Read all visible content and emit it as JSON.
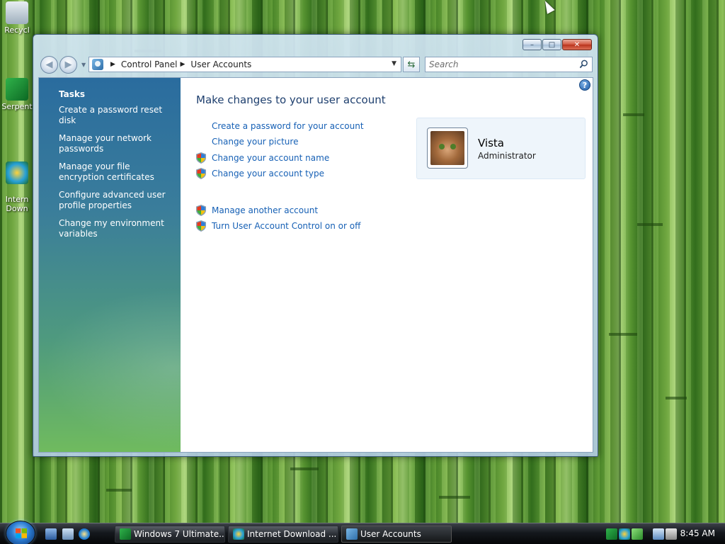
{
  "desktop": {
    "icons": [
      {
        "label": "Recycl",
        "icon": "recycle-bin-icon"
      },
      {
        "label": "Serpent",
        "icon": "serpent-icon"
      },
      {
        "label": "Intern\nDown",
        "icon": "internet-download-icon"
      }
    ]
  },
  "window": {
    "controls": {
      "minimize": "–",
      "maximize": "□",
      "close": "✕"
    },
    "nav": {
      "back": "◀",
      "forward": "▶",
      "breadcrumb": [
        "Control Panel",
        "User Accounts"
      ]
    },
    "search": {
      "placeholder": "Search"
    },
    "sidebar": {
      "heading": "Tasks",
      "links": [
        "Create a password reset disk",
        "Manage your network passwords",
        "Manage your file encryption certificates",
        "Configure advanced user profile properties",
        "Change my environment variables"
      ]
    },
    "main": {
      "title": "Make changes to your user account",
      "help": "?",
      "tasks": [
        {
          "label": "Create a password for your account",
          "shield": false
        },
        {
          "label": "Change your picture",
          "shield": false
        },
        {
          "label": "Change your account name",
          "shield": true
        },
        {
          "label": "Change your account type",
          "shield": true
        }
      ],
      "more_tasks": [
        {
          "label": "Manage another account",
          "shield": true
        },
        {
          "label": "Turn User Account Control on or off",
          "shield": true
        }
      ],
      "account": {
        "name": "Vista",
        "role": "Administrator"
      }
    }
  },
  "taskbar": {
    "buttons": [
      {
        "label": "Windows 7 Ultimate...",
        "icon": "serpent-icon",
        "active": false
      },
      {
        "label": "Internet Download ...",
        "icon": "internet-download-icon",
        "active": false
      },
      {
        "label": "User Accounts",
        "icon": "user-accounts-icon",
        "active": true
      }
    ],
    "clock": "8:45 AM"
  },
  "colors": {
    "link": "#1660b5",
    "title": "#1e3f6e",
    "sidebar_top": "#2a6c9e",
    "sidebar_bottom": "#70bb5e"
  }
}
